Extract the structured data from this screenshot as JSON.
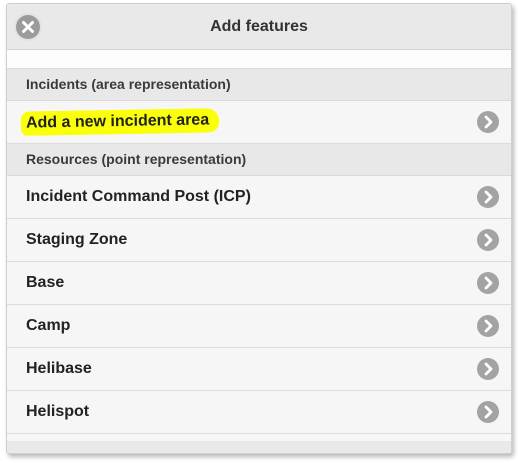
{
  "header": {
    "title": "Add features",
    "close_icon": "close-icon"
  },
  "groups": [
    {
      "heading": "Incidents (area representation)",
      "items": [
        {
          "label": "Add a new incident area",
          "highlighted": true,
          "icon": "chevron-right-icon"
        }
      ]
    },
    {
      "heading": "Resources (point representation)",
      "items": [
        {
          "label": "Incident Command Post (ICP)",
          "icon": "chevron-right-icon"
        },
        {
          "label": "Staging Zone",
          "icon": "chevron-right-icon"
        },
        {
          "label": "Base",
          "icon": "chevron-right-icon"
        },
        {
          "label": "Camp",
          "icon": "chevron-right-icon"
        },
        {
          "label": "Helibase",
          "icon": "chevron-right-icon"
        },
        {
          "label": "Helispot",
          "icon": "chevron-right-icon"
        }
      ]
    }
  ],
  "colors": {
    "highlight": "#faff0a",
    "icon_gray": "#a3a3a3"
  }
}
